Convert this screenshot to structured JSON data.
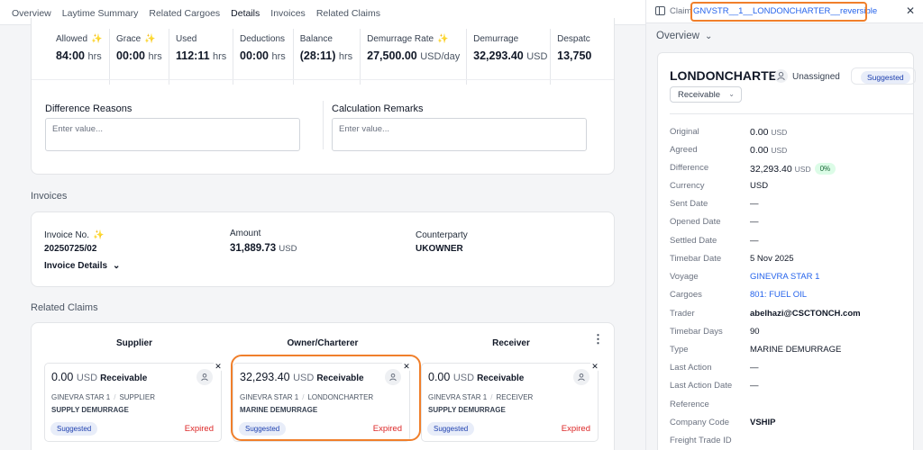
{
  "tabs": [
    "Overview",
    "Laytime Summary",
    "Related Cargoes",
    "Details",
    "Invoices",
    "Related Claims"
  ],
  "stats": [
    {
      "label": "Allowed",
      "value": "84:00",
      "unit": "hrs",
      "icon": "sparkle-icon"
    },
    {
      "label": "Grace",
      "value": "00:00",
      "unit": "hrs",
      "icon": "sparkle-icon"
    },
    {
      "label": "Used",
      "value": "112:11",
      "unit": "hrs"
    },
    {
      "label": "Deductions",
      "value": "00:00",
      "unit": "hrs"
    },
    {
      "label": "Balance",
      "value": "(28:11)",
      "unit": "hrs"
    },
    {
      "label": "Demurrage Rate",
      "value": "27,500.00",
      "unit": "USD/day",
      "icon": "sparkle-icon"
    },
    {
      "label": "Demurrage",
      "value": "32,293.40",
      "unit": "USD"
    },
    {
      "label": "Despatc",
      "value": "13,750",
      "unit": ""
    }
  ],
  "difference_reasons": {
    "label": "Difference Reasons",
    "placeholder": "Enter value..."
  },
  "calculation_remarks": {
    "label": "Calculation Remarks",
    "placeholder": "Enter value..."
  },
  "invoices": {
    "title": "Invoices",
    "invoice_no_label": "Invoice No.",
    "invoice_no": "20250725/02",
    "amount_label": "Amount",
    "amount": "31,889.73",
    "amount_unit": "USD",
    "counterparty_label": "Counterparty",
    "counterparty": "UKOWNER",
    "details_label": "Invoice Details"
  },
  "related_claims": {
    "title": "Related Claims",
    "columns": [
      "Supplier",
      "Owner/Charterer",
      "Receiver"
    ],
    "claims": [
      {
        "amount": "0.00",
        "unit": "USD",
        "direction": "Receivable",
        "vessel": "GINEVRA STAR 1",
        "party": "SUPPLIER",
        "type": "SUPPLY DEMURRAGE",
        "badge": "Suggested",
        "status": "Expired"
      },
      {
        "amount": "32,293.40",
        "unit": "USD",
        "direction": "Receivable",
        "vessel": "GINEVRA STAR 1",
        "party": "LONDONCHARTER",
        "type": "MARINE DEMURRAGE",
        "badge": "Suggested",
        "status": "Expired"
      },
      {
        "amount": "0.00",
        "unit": "USD",
        "direction": "Receivable",
        "vessel": "GINEVRA STAR 1",
        "party": "RECEIVER",
        "type": "SUPPLY DEMURRAGE",
        "badge": "Suggested",
        "status": "Expired"
      }
    ]
  },
  "panel": {
    "claim_prefix": "Claim",
    "claim_link": "GNVSTR__1__LONDONCHARTER__reversible",
    "overview_label": "Overview",
    "title": "LONDONCHARTER",
    "assignee": "Unassigned",
    "badge": "Suggested",
    "direction": "Receivable",
    "rows": {
      "original": {
        "label": "Original",
        "value": "0.00",
        "unit": "USD"
      },
      "agreed": {
        "label": "Agreed",
        "value": "0.00",
        "unit": "USD"
      },
      "difference": {
        "label": "Difference",
        "value": "32,293.40",
        "unit": "USD",
        "pct": "0%"
      },
      "currency": {
        "label": "Currency",
        "value": "USD"
      },
      "sent_date": {
        "label": "Sent Date",
        "value": "—"
      },
      "opened_date": {
        "label": "Opened Date",
        "value": "—"
      },
      "settled_date": {
        "label": "Settled Date",
        "value": "—"
      },
      "timebar_date": {
        "label": "Timebar Date",
        "value": "5 Nov 2025"
      },
      "voyage": {
        "label": "Voyage",
        "value": "GINEVRA STAR 1"
      },
      "cargoes": {
        "label": "Cargoes",
        "value": "801: FUEL OIL"
      },
      "trader": {
        "label": "Trader",
        "value": "abelhazi@CSCTONCH.com"
      },
      "timebar_days": {
        "label": "Timebar Days",
        "value": "90"
      },
      "type": {
        "label": "Type",
        "value": "MARINE DEMURRAGE"
      },
      "last_action": {
        "label": "Last Action",
        "value": "—"
      },
      "last_action_date": {
        "label": "Last Action Date",
        "value": "—"
      },
      "reference": {
        "label": "Reference",
        "value": ""
      },
      "company_code": {
        "label": "Company Code",
        "value": "VSHIP"
      },
      "freight_trade_id": {
        "label": "Freight Trade ID",
        "value": ""
      }
    }
  },
  "colors": {
    "accent": "#2563eb",
    "highlight": "#f07f2b",
    "expired": "#dc2626"
  }
}
